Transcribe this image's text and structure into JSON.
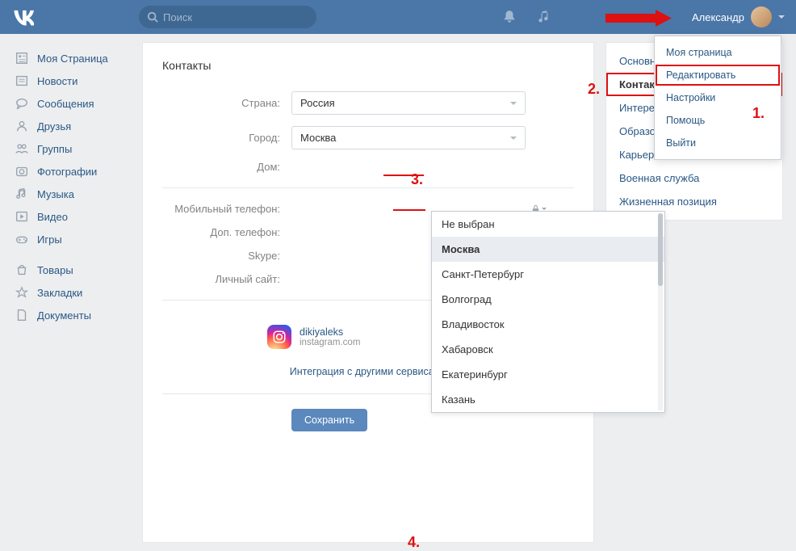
{
  "header": {
    "search_placeholder": "Поиск",
    "username": "Александр"
  },
  "sidebar": {
    "items": [
      {
        "label": "Моя Страница"
      },
      {
        "label": "Новости"
      },
      {
        "label": "Сообщения"
      },
      {
        "label": "Друзья"
      },
      {
        "label": "Группы"
      },
      {
        "label": "Фотографии"
      },
      {
        "label": "Музыка"
      },
      {
        "label": "Видео"
      },
      {
        "label": "Игры"
      }
    ],
    "items2": [
      {
        "label": "Товары"
      },
      {
        "label": "Закладки"
      },
      {
        "label": "Документы"
      }
    ]
  },
  "main": {
    "title": "Контакты",
    "country_label": "Страна:",
    "country_value": "Россия",
    "city_label": "Город:",
    "city_value": "Москва",
    "home_label": "Дом:",
    "mobile_label": "Мобильный телефон:",
    "extra_phone_label": "Доп. телефон:",
    "skype_label": "Skype:",
    "site_label": "Личный сайт:",
    "save_label": "Сохранить",
    "integration_name": "dikiyaleks",
    "integration_domain": "instagram.com",
    "other_services": "Интеграция с другими сервисами"
  },
  "city_options": [
    "Не выбран",
    "Москва",
    "Санкт-Петербург",
    "Волгоград",
    "Владивосток",
    "Хабаровск",
    "Екатеринбург",
    "Казань"
  ],
  "rightnav": [
    "Основное",
    "Контакты",
    "Интересы",
    "Образование",
    "Карьера",
    "Военная служба",
    "Жизненная позиция"
  ],
  "profile_menu": [
    "Моя страница",
    "Редактировать",
    "Настройки",
    "Помощь",
    "Выйти"
  ],
  "annotations": {
    "a1": "1.",
    "a2": "2.",
    "a3": "3.",
    "a4": "4."
  }
}
